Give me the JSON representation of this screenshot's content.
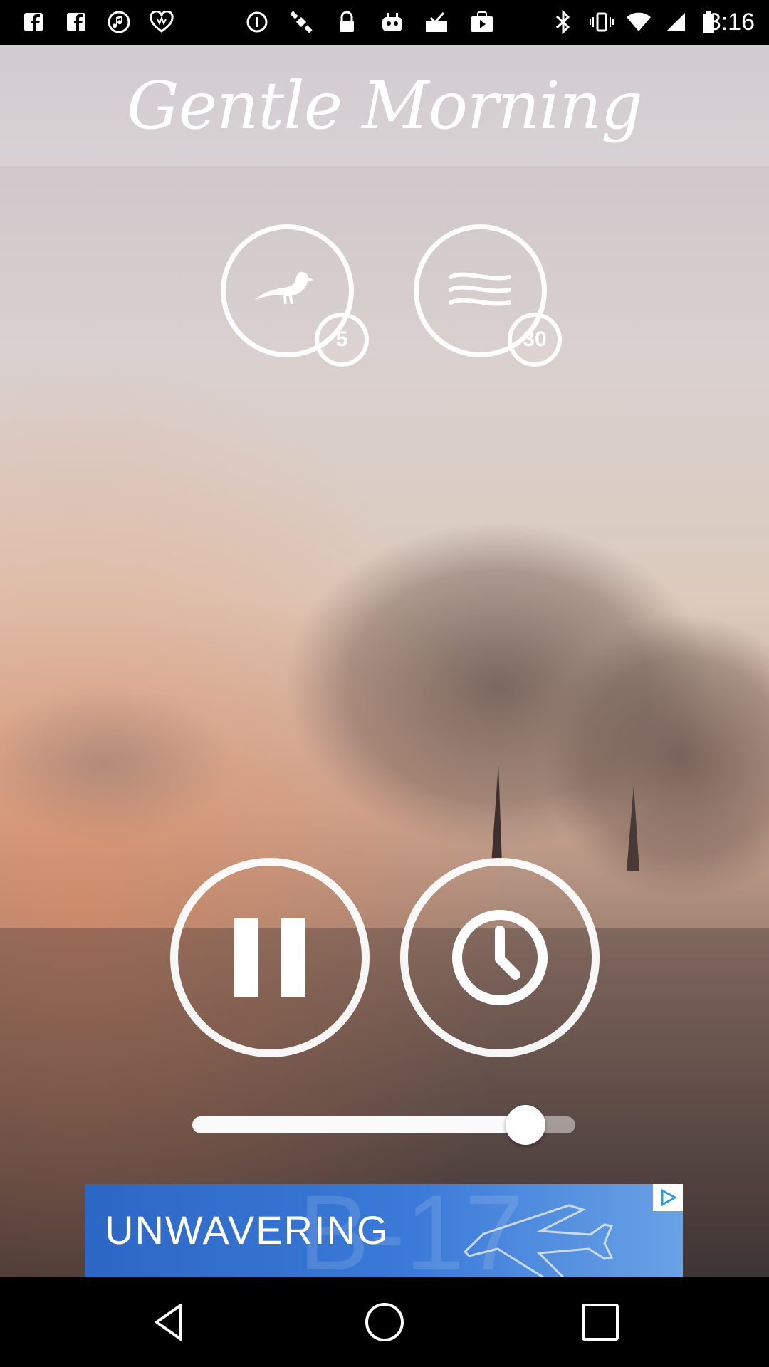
{
  "status_bar": {
    "time": "3:16",
    "left_icons": [
      "facebook-icon",
      "facebook-icon",
      "music-icon",
      "iheart-icon",
      "info-icon",
      "satellite-icon",
      "lock-icon",
      "robot-icon",
      "checklist-icon",
      "youtube-icon"
    ],
    "right_icons": [
      "bluetooth-icon",
      "vibrate-icon",
      "wifi-icon",
      "signal-icon",
      "battery-icon"
    ]
  },
  "header": {
    "title": "Gentle Morning"
  },
  "sound_controls": [
    {
      "name": "birds",
      "icon": "bird-icon",
      "badge": "5"
    },
    {
      "name": "wind",
      "icon": "wind-icon",
      "badge": "30"
    }
  ],
  "playback": {
    "pause_icon": "pause-icon",
    "timer_icon": "clock-icon"
  },
  "volume": {
    "level": 0.87
  },
  "ad": {
    "text": "UNWAVERING",
    "corner_icon": "adchoices-icon"
  },
  "nav_bar": {
    "back_icon": "back-icon",
    "home_icon": "home-icon",
    "recents_icon": "recents-icon"
  },
  "colors": {
    "ad_blue": "#2d67c5",
    "white": "#ffffff"
  }
}
